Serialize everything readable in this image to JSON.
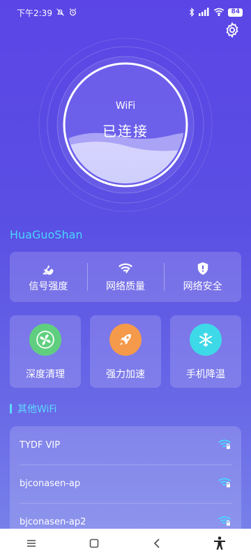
{
  "status_bar": {
    "time": "下午2:39",
    "battery": "84",
    "icons": [
      "silent-mode-icon",
      "alarm-icon",
      "bluetooth-icon",
      "signal-icon",
      "wifi-icon",
      "battery-icon"
    ]
  },
  "hero": {
    "wifi_word": "WiFi",
    "connection_status": "已连接"
  },
  "network": {
    "ssid": "HuaGuoShan"
  },
  "metrics": [
    {
      "label": "信号强度",
      "icon": "satellite-dish-icon"
    },
    {
      "label": "网络质量",
      "icon": "wifi-quality-icon"
    },
    {
      "label": "网络安全",
      "icon": "shield-icon"
    }
  ],
  "tools": [
    {
      "label": "深度清理",
      "icon": "fan-icon",
      "color": "#5fcf7f"
    },
    {
      "label": "强力加速",
      "icon": "rocket-icon",
      "color": "#f49a4a"
    },
    {
      "label": "手机降温",
      "icon": "snowflake-icon",
      "color": "#3ed9e8"
    }
  ],
  "other_wifi": {
    "title": "其他WiFi",
    "items": [
      {
        "name": "TYDF VIP"
      },
      {
        "name": "bjconasen-ap"
      },
      {
        "name": "bjconasen-ap2"
      }
    ]
  },
  "colors": {
    "accent": "#49d6ff",
    "background_top": "#5b45e6",
    "background_bottom": "#7a86ea"
  }
}
